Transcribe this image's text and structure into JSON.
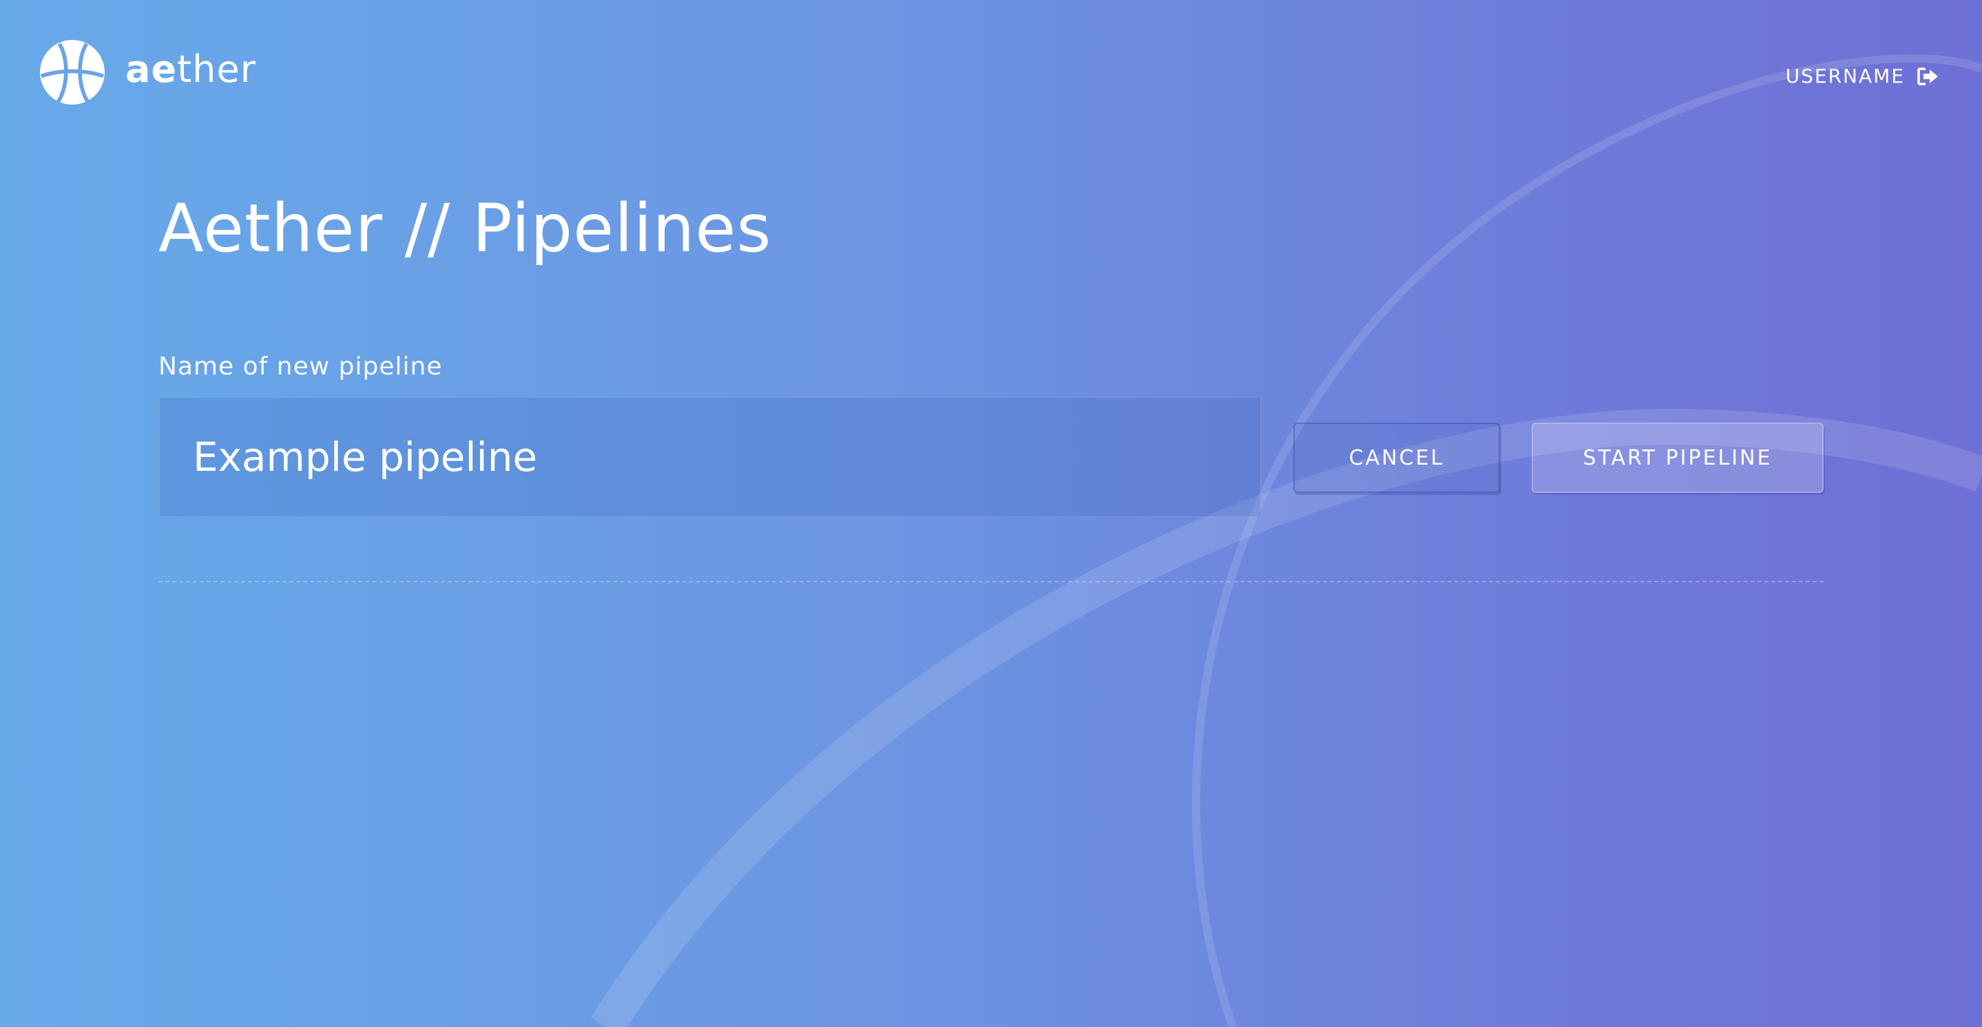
{
  "app": {
    "logo_bold": "ae",
    "logo_light": "ther"
  },
  "header": {
    "username": "USERNAME",
    "logout_icon": "sign-out-icon"
  },
  "page": {
    "title": "Aether // Pipelines"
  },
  "new_pipeline": {
    "label": "Name of new pipeline",
    "value": "Example pipeline",
    "cancel_label": "CANCEL",
    "start_label": "START PIPELINE"
  },
  "colors": {
    "gradient_start": "#67aaea",
    "gradient_end": "#6e70d5",
    "text": "#ffffff"
  }
}
